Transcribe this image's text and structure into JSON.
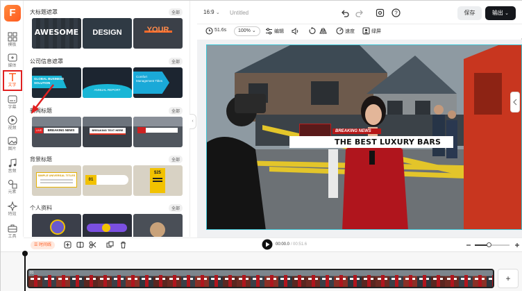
{
  "app": {
    "logo": "F"
  },
  "rail": [
    {
      "label": "模板",
      "icon": "grid-icon"
    },
    {
      "label": "媒体",
      "icon": "media-icon"
    },
    {
      "label": "文字",
      "icon": "text-icon",
      "active": true
    },
    {
      "label": "字幕",
      "icon": "subtitle-icon"
    },
    {
      "label": "视频",
      "icon": "video-icon"
    },
    {
      "label": "图片",
      "icon": "image-icon"
    },
    {
      "label": "音频",
      "icon": "music-icon"
    },
    {
      "label": "元素",
      "icon": "shapes-icon"
    },
    {
      "label": "特效",
      "icon": "effects-icon"
    },
    {
      "label": "工具",
      "icon": "toolbox-icon"
    }
  ],
  "panel": {
    "all_label": "全部",
    "sections": [
      {
        "title": "大标题遮罩",
        "thumbs": [
          "AWESOME",
          "DESIGN",
          "YOUR"
        ]
      },
      {
        "title": "公司信息遮罩",
        "thumbs": [
          "GLOBAL BUSINESS SOLUTION",
          "ANNUAL REPORT",
          "Comfort Management Titles"
        ]
      },
      {
        "title": "新闻标题",
        "thumbs": [
          "BREAKING NEWS",
          "BREAKING TEXT HERE",
          ""
        ]
      },
      {
        "title": "背景标题",
        "thumbs": [
          "SIMPLE UNIVERSAL TITLES",
          "01",
          "$25"
        ]
      },
      {
        "title": "个人资料",
        "thumbs": [
          "",
          "",
          ""
        ]
      }
    ]
  },
  "topbar": {
    "aspect": "16:9",
    "project_title": "Untitled",
    "save_label": "保存",
    "export_label": "输出"
  },
  "toolbar": {
    "duration": "51.6s",
    "zoom": "100%",
    "edit": "编辑",
    "speed": "速度",
    "greenscreen": "绿屏"
  },
  "overlay": {
    "tag": "BREAKING NEWS",
    "headline": "THE BEST LUXURY BARS"
  },
  "timeline": {
    "label": "时间线",
    "current": "00:00.0",
    "total": "00:51.6",
    "track_number": "01",
    "add": "+"
  }
}
